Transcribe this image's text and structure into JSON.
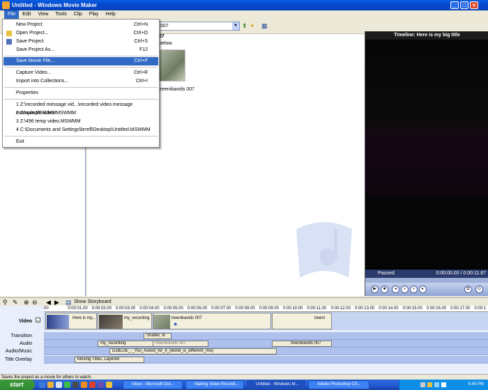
{
  "window": {
    "title": "Untitled - Windows Movie Maker"
  },
  "menubar": [
    "File",
    "Edit",
    "View",
    "Tools",
    "Clip",
    "Play",
    "Help"
  ],
  "file_menu": {
    "items": [
      {
        "label": "New Project",
        "shortcut": "Ctrl+N"
      },
      {
        "label": "Open Project...",
        "shortcut": "Ctrl+O"
      },
      {
        "label": "Save Project",
        "shortcut": "Ctrl+S"
      },
      {
        "label": "Save Project As...",
        "shortcut": "F12"
      },
      {
        "label": "Save Movie File...",
        "shortcut": "Ctrl+P"
      },
      {
        "label": "Capture Video...",
        "shortcut": "Ctrl+R"
      },
      {
        "label": "Import into Collections...",
        "shortcut": "Ctrl+I"
      },
      {
        "label": "Properties",
        "shortcut": ""
      },
      {
        "label": "1 Z:\\recorded message vid...\\recorded video message example.MSWMM",
        "shortcut": ""
      },
      {
        "label": "2 Z:\\sample video.MSWMM",
        "shortcut": ""
      },
      {
        "label": "3 Z:\\496 temp video.MSWMM",
        "shortcut": ""
      },
      {
        "label": "4 C:\\Documents and Settings\\brrell\\Desktop\\Untitled.MSWMM",
        "shortcut": ""
      },
      {
        "label": "Exit",
        "shortcut": ""
      }
    ]
  },
  "toolbar": {
    "collection_value": "007"
  },
  "contents": {
    "heading": "07",
    "sub": "below.",
    "clip_name": "treenikavids 007"
  },
  "preview": {
    "title": "Timeline: Here is my big title",
    "status": "Paused",
    "time": "0:00:00.00 / 0:00:11.87"
  },
  "timeline": {
    "show_storyboard": "Show Storyboard",
    "ruler": [
      "00",
      "0:00:01.00",
      "0:00:02.00",
      "0:00:03.00",
      "0:00:04.00",
      "0:00:05.00",
      "0:00:06.00",
      "0:00:07.00",
      "0:00:08.00",
      "0:00:09.00",
      "0:00:10.00",
      "0:00:11.00",
      "0:00:12.00",
      "0:00:13.00",
      "0:00:14.00",
      "0:00:15.00",
      "0:00:16.00",
      "0:00:17.00",
      "0:00:1"
    ],
    "tracks": [
      "Video",
      "Transition",
      "Audio",
      "Audio/Music",
      "Title Overlay"
    ],
    "video_clips": [
      "Here is my...",
      "my_recording",
      "treenikavids 007",
      "treeni"
    ],
    "transition": "Shatter, In",
    "audio_clips": [
      "my_recording",
      "treenikavids 007",
      "treenikavids 007"
    ],
    "music": "DJBLUE_-_You_Asked_for_it_(world_is_different_mix)",
    "title_overlay": "Moving Titles, Layered"
  },
  "statusbar": "Saves the project as a movie for others to watch.",
  "taskbar": {
    "start": "start",
    "tasks": [
      "Inbox - Microsoft Out...",
      "Making Video Recordi...",
      "Untitled - Windows M...",
      "Adobe Photoshop CS..."
    ],
    "clock": "5:45 PM"
  }
}
